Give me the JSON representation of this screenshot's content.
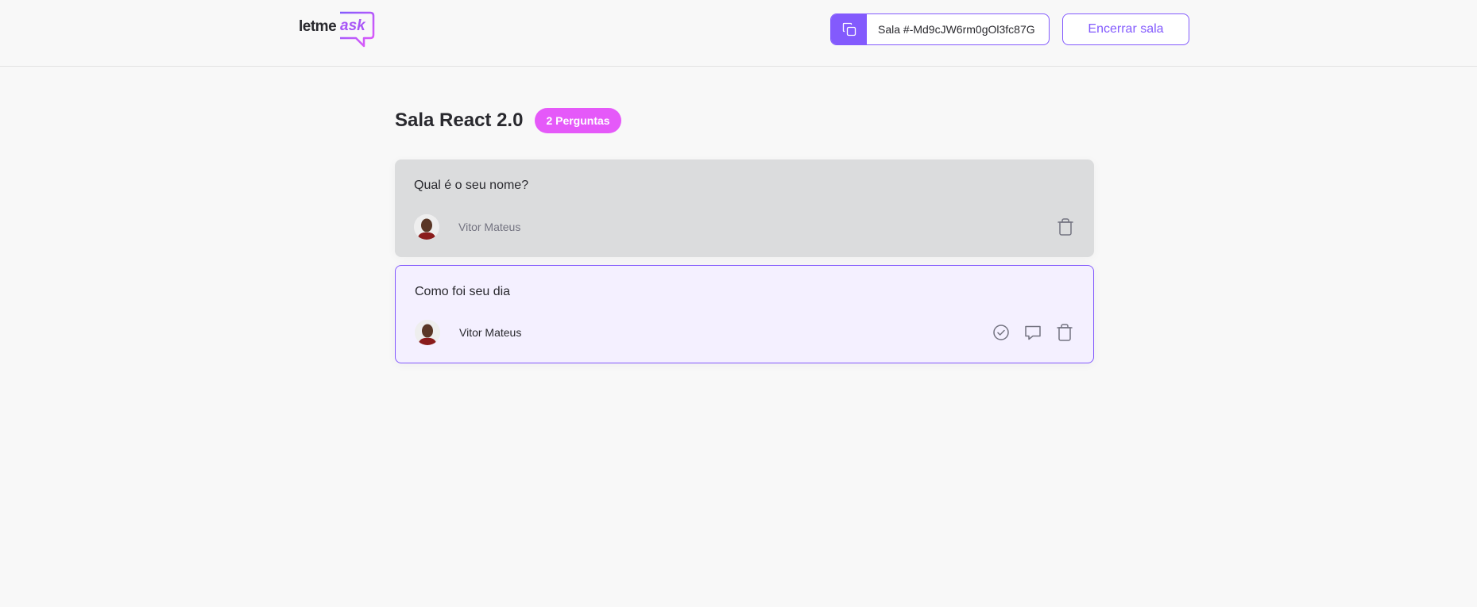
{
  "header": {
    "logo_main": "letme",
    "logo_accent": "ask",
    "room_code_label": "Sala #-Md9cJW6rm0gOl3fc87G",
    "end_room_label": "Encerrar sala"
  },
  "room": {
    "title": "Sala React 2.0",
    "question_count_label": "2 Perguntas"
  },
  "questions": [
    {
      "content": "Qual é o seu nome?",
      "author": "Vitor Mateus",
      "state": "answered"
    },
    {
      "content": "Como foi seu dia",
      "author": "Vitor Mateus",
      "state": "highlighted"
    }
  ],
  "colors": {
    "accent": "#835afd",
    "badge": "#e559f9",
    "answered_bg": "#dbdcdd",
    "highlighted_bg": "#f4f0ff"
  }
}
